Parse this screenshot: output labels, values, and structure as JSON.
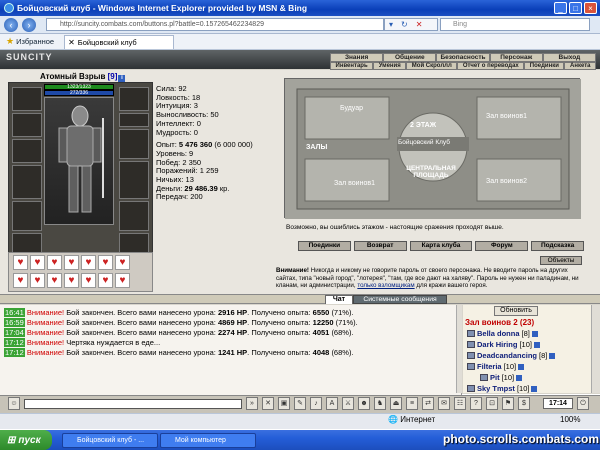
{
  "window": {
    "title": "Бойцовский клуб - Windows Internet Explorer provided by MSN & Bing"
  },
  "address": {
    "url": "http://suncity.combats.com/buttons.pl?battle=0.157265462234829",
    "search_placeholder": "Bing"
  },
  "favorites": {
    "label": "Избранное",
    "tab_title": "Бойцовский клуб"
  },
  "game": {
    "logo": "SUNCITY",
    "menu_top": [
      "Знания",
      "Общение",
      "Безопасность",
      "Персонаж",
      "Выход"
    ],
    "menu_bottom": [
      "Инвентарь",
      "Умения",
      "Мой Скроллл",
      "Отчет о переводах",
      "Поединки",
      "Анкета"
    ]
  },
  "character": {
    "name": "Атомный Взрыв",
    "level": "[9]",
    "hp": "1323/1323",
    "mp": "272/336",
    "stats": {
      "strength": "Сила: 92",
      "agility": "Ловкость: 18",
      "intuition": "Интуиция: 3",
      "endurance": "Выносливость: 50",
      "intellect": "Интеллект: 0",
      "wisdom": "Мудрость: 0"
    },
    "experience_label": "Опыт:",
    "experience_value": "5 476 360",
    "experience_next": "(6 000 000)",
    "level_line": "Уровень: 9",
    "wins": "Побед: 2 350",
    "losses": "Поражений: 1 259",
    "draws": "Ничьих: 13",
    "money_label": "Деньги:",
    "money_value": "29 486.39",
    "money_unit": "кр.",
    "transfers": "Передач: 200"
  },
  "map": {
    "rooms": [
      "Будуар",
      "Зал воинов1",
      "2 ЭТАЖ",
      "Бойцовский Клуб",
      "ЗАЛЫ",
      "ЦЕНТРАЛЬНАЯ ПЛОЩАДЬ",
      "Зал воинов1",
      "Зал воинов2"
    ],
    "note": "Возможно, вы ошиблись этажом - настоящие сражения проходят выше."
  },
  "nav_buttons": [
    "Поединки",
    "Возврат",
    "Карта клуба",
    "Форум",
    "Подсказка"
  ],
  "objects_button": "Объекты",
  "warning": {
    "label": "Внимание!",
    "text": "Никогда и никому не говорите пароль от своего персонажа. Не вводите пароль на других сайтах, типа \"новый город\", \"лотерея\", \"там, где все дают на халяву\". Пароль не нужен ни паладинам, ни кланам, ни администрации,",
    "link": "только взломщикам",
    "tail": "для кражи вашего героя."
  },
  "chat_tabs": {
    "chat": "Чат",
    "system": "Системные сообщения"
  },
  "chat_log": [
    {
      "time": "16:41",
      "warn": "Внимание!",
      "pre": "Бой закончен. Всего вами нанесено урона:",
      "damage": "2916 HP",
      "mid": ". Получено опыта:",
      "exp": "6550",
      "pct": "(71%)."
    },
    {
      "time": "16:59",
      "warn": "Внимание!",
      "pre": "Бой закончен. Всего вами нанесено урона:",
      "damage": "4869 HP",
      "mid": ". Получено опыта:",
      "exp": "12250",
      "pct": "(71%)."
    },
    {
      "time": "17:04",
      "warn": "Внимание!",
      "pre": "Бой закончен. Всего вами нанесено урона:",
      "damage": "2274 HP",
      "mid": ". Получено опыта:",
      "exp": "4051",
      "pct": "(68%)."
    },
    {
      "time": "17:12",
      "warn": "Внимание!",
      "pre": "Чертяка нуждается в еде...",
      "damage": "",
      "mid": "",
      "exp": "",
      "pct": ""
    },
    {
      "time": "17:12",
      "warn": "Внимание!",
      "pre": "Бой закончен. Всего вами нанесено урона:",
      "damage": "1241 HP",
      "mid": ". Получено опыта:",
      "exp": "4048",
      "pct": "(68%)."
    }
  ],
  "users": {
    "refresh": "Обновить",
    "room": "Зал воинов 2 (23)",
    "list": [
      {
        "name": "Bella donna",
        "level": "[8]"
      },
      {
        "name": "Dark Hiring",
        "level": "[10]"
      },
      {
        "name": "Deadcandancing",
        "level": "[8]"
      },
      {
        "name": "Filteria",
        "level": "[10]"
      },
      {
        "name": "Pit",
        "level": "[10]"
      },
      {
        "name": "Sky Tmpst",
        "level": "[10]"
      }
    ]
  },
  "toolbar": {
    "clock": "17:14"
  },
  "status": {
    "zone": "Интернет",
    "zoom": "100%"
  },
  "taskbar": {
    "start": "пуск",
    "items": [
      "Бойцовский клуб - ...",
      "Мой компьютер"
    ]
  },
  "watermark": "photo.scrolls.combats.com",
  "colors": {
    "title_bar": "#0a3fb8",
    "hp_bar": "#1d8a1d",
    "mp_bar": "#1f4aa8",
    "warning_red": "#d00000",
    "room_red": "#c00000",
    "user_blue": "#10207a",
    "taskbar_blue": "#245ed8",
    "start_green": "#2d8a2a"
  }
}
